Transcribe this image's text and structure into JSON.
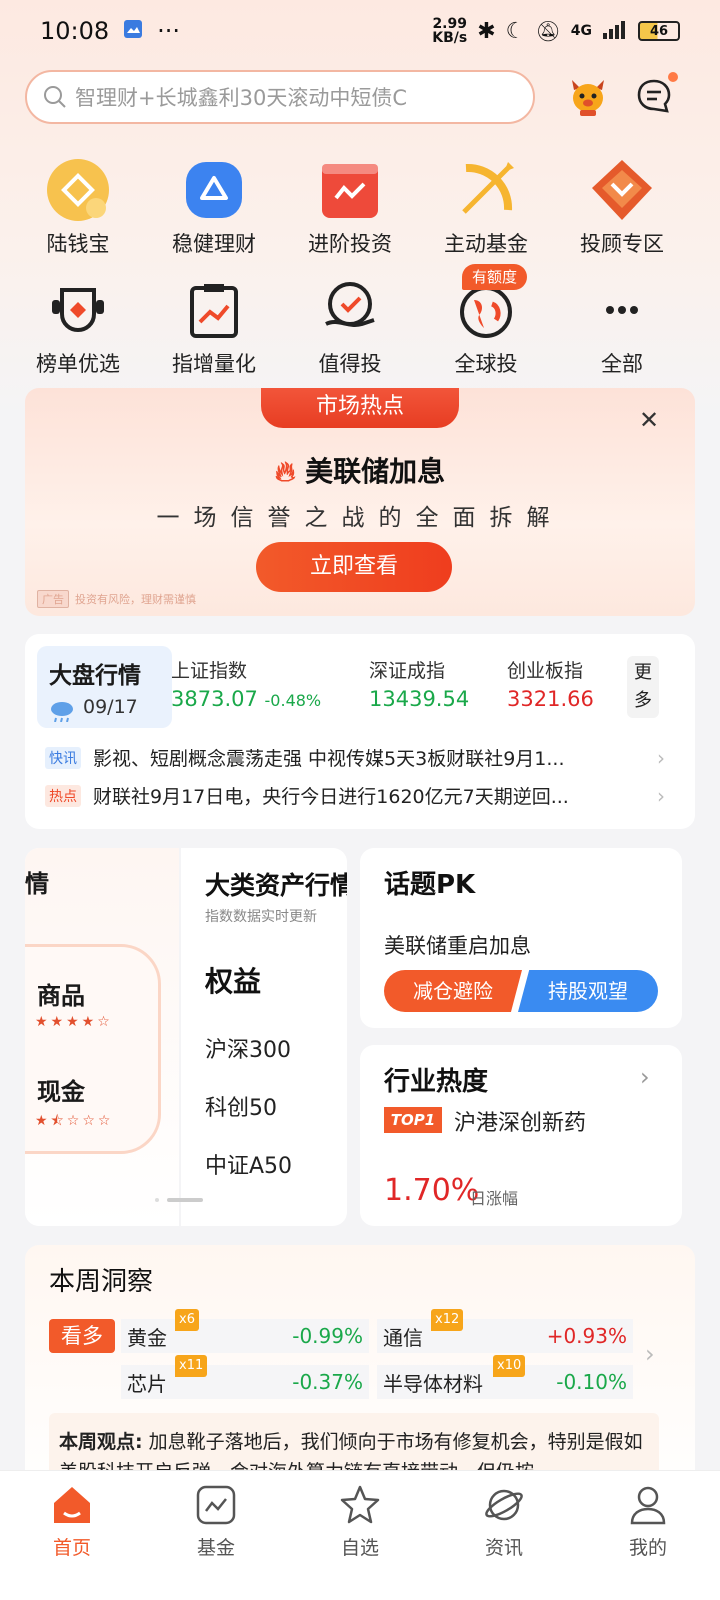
{
  "status": {
    "time": "10:08",
    "net_speed_value": "2.99",
    "net_speed_unit": "KB/s",
    "network": "4G",
    "battery": "46"
  },
  "search": {
    "placeholder": "智理财+长城鑫利30天滚动中短债C"
  },
  "quick_grid_row1": [
    {
      "label": "陆钱宝",
      "icon": "coin-icon"
    },
    {
      "label": "稳健理财",
      "icon": "shield-icon"
    },
    {
      "label": "进阶投资",
      "icon": "chart-icon"
    },
    {
      "label": "主动基金",
      "icon": "bow-arrow-icon"
    },
    {
      "label": "投顾专区",
      "icon": "fox-badge-icon"
    }
  ],
  "quick_grid_row2": [
    {
      "label": "榜单优选",
      "icon": "trophy-icon"
    },
    {
      "label": "指增量化",
      "icon": "clipboard-chart-icon"
    },
    {
      "label": "值得投",
      "icon": "check-hand-icon"
    },
    {
      "label": "全球投",
      "icon": "globe-icon",
      "badge": "有额度"
    },
    {
      "label": "全部",
      "icon": "more-icon"
    }
  ],
  "banner": {
    "tag": "市场热点",
    "title": "美联储加息",
    "subtitle": "一场信誉之战的全面拆解",
    "cta": "立即查看",
    "ad_label": "广告",
    "ad_note": "投资有风险，理财需谨慎"
  },
  "market": {
    "title": "大盘行情",
    "date": "09/17",
    "indices": [
      {
        "name": "上证指数",
        "value": "3873.07",
        "change": "-0.48%"
      },
      {
        "name": "深证成指",
        "value": "13439.54"
      },
      {
        "name": "创业板指",
        "value": "3321.66"
      }
    ],
    "more": "更多",
    "news": [
      {
        "tag": "快讯",
        "text": "影视、短剧概念震荡走强 中视传媒5天3板财联社9月1..."
      },
      {
        "tag": "热点",
        "text": "财联社9月17日电，央行今日进行1620亿元7天期逆回..."
      }
    ]
  },
  "asset": {
    "ghost_left": "情",
    "items_left": [
      {
        "label": "商品",
        "stars": "★★★★☆"
      },
      {
        "label": "现金",
        "stars": "★⯪☆☆☆"
      }
    ],
    "title": "大类资产行情",
    "subtitle": "指数数据实时更新",
    "category": "权益",
    "indices": [
      "沪深300",
      "科创50",
      "中证A50"
    ]
  },
  "topic": {
    "title": "话题PK",
    "question": "美联储重启加息",
    "option_a": "减仓避险",
    "option_b": "持股观望"
  },
  "industry": {
    "title": "行业热度",
    "rank": "TOP1",
    "name": "沪港深创新药",
    "change": "1.70%",
    "change_label": "日涨幅"
  },
  "insight": {
    "title": "本周洞察",
    "stance": "看多",
    "items": [
      {
        "name": "黄金",
        "mult": "x6",
        "change": "-0.99%"
      },
      {
        "name": "通信",
        "mult": "x12",
        "change": "+0.93%"
      },
      {
        "name": "芯片",
        "mult": "x11",
        "change": "-0.37%"
      },
      {
        "name": "半导体材料",
        "mult": "x10",
        "change": "-0.10%"
      }
    ],
    "view_label": "本周观点:",
    "view_text": "加息靴子落地后，我们倾向于市场有修复机会，特别是假如美股科技开启反弹，会对海外算力链有直接带动，但仍按"
  },
  "tabs": [
    {
      "label": "首页",
      "icon": "home-icon"
    },
    {
      "label": "基金",
      "icon": "fund-icon"
    },
    {
      "label": "自选",
      "icon": "star-icon"
    },
    {
      "label": "资讯",
      "icon": "planet-icon"
    },
    {
      "label": "我的",
      "icon": "user-icon"
    }
  ],
  "colors": {
    "accent": "#f25a2a",
    "rise": "#e02727",
    "fall": "#1aa84a",
    "blue": "#3a8bf1"
  }
}
